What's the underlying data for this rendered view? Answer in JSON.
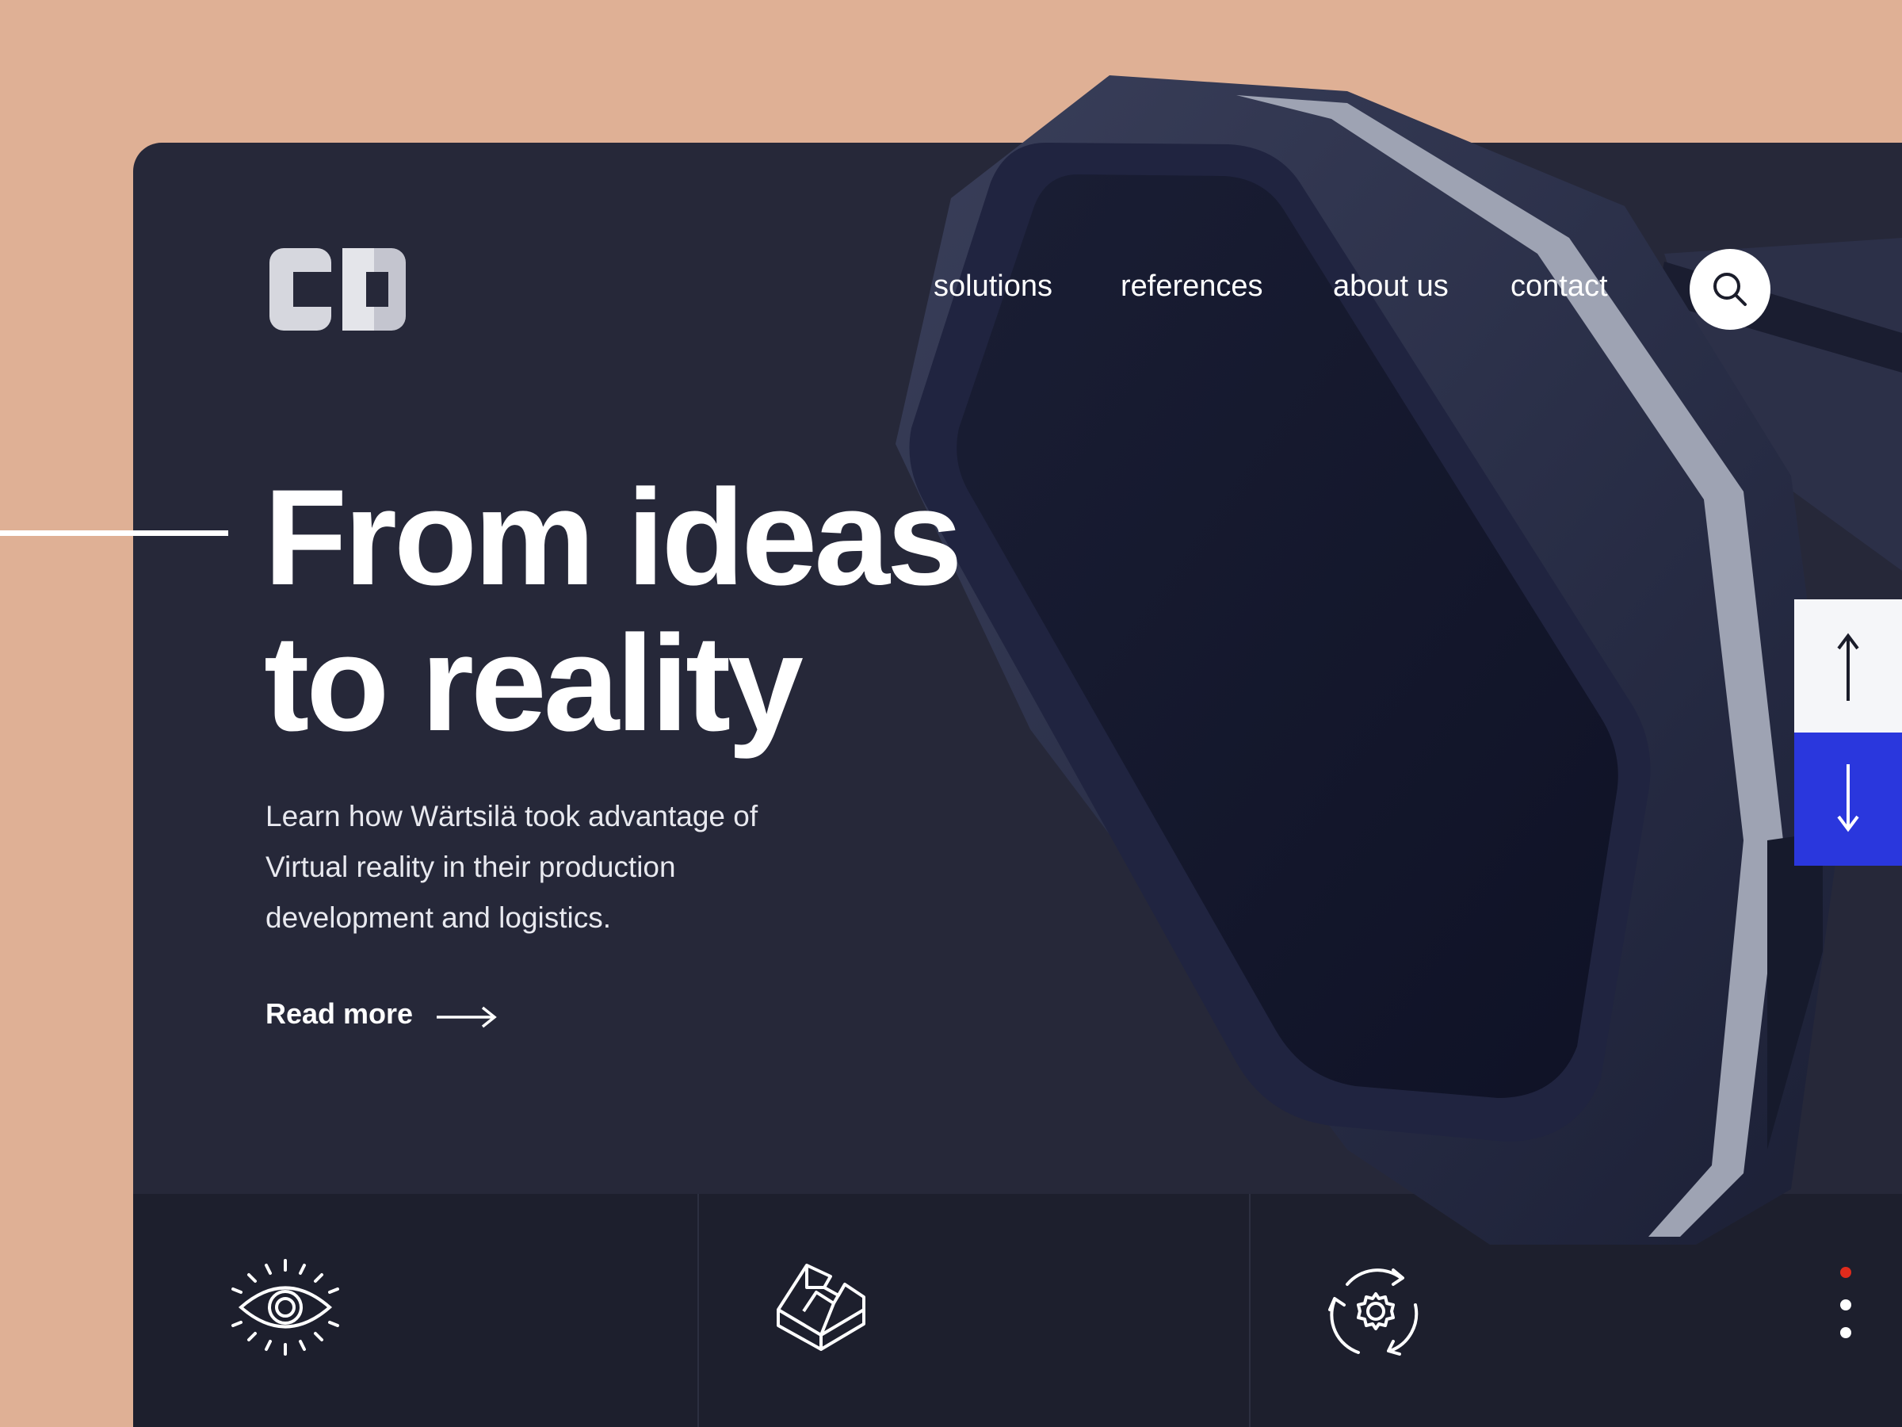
{
  "brand": {
    "logo_text": "co"
  },
  "nav": {
    "items": [
      {
        "label": "solutions"
      },
      {
        "label": "references"
      },
      {
        "label": "about us"
      },
      {
        "label": "contact"
      }
    ],
    "search_icon": "search-icon"
  },
  "hero": {
    "headline_line1": "From ideas",
    "headline_line2": "to reality",
    "description": "Learn how Wärtsilä took advantage of Virtual reality in their production development and logistics.",
    "cta_label": "Read more",
    "cta_icon": "arrow-right-icon"
  },
  "scroll_controls": {
    "up_icon": "arrow-up-icon",
    "down_icon": "arrow-down-icon",
    "active_color": "#2a37dd"
  },
  "features": [
    {
      "icon": "eye-icon"
    },
    {
      "icon": "3d-block-icon"
    },
    {
      "icon": "gear-cycle-icon"
    }
  ],
  "pagination": {
    "total": 3,
    "active_index": 0,
    "active_color": "#e02b1c"
  },
  "colors": {
    "background": "#dfb095",
    "card": "#262839",
    "bottom_bar": "#1d1f2d",
    "text": "#ffffff"
  }
}
